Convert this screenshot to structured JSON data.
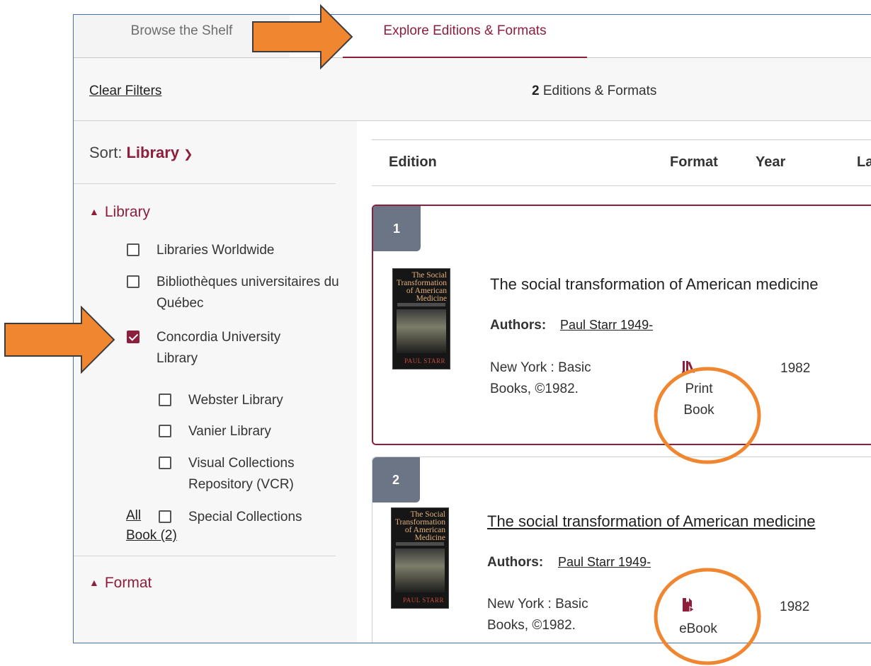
{
  "tabs": {
    "shelf": "Browse the Shelf",
    "editions": "Explore Editions & Formats"
  },
  "filter_bar": {
    "clear": "Clear Filters",
    "count": "2",
    "count_suffix": " Editions & Formats"
  },
  "sort": {
    "label": "Sort:",
    "value": "Library"
  },
  "library_section": {
    "heading": "Library",
    "options": [
      {
        "label": "Libraries Worldwide",
        "checked": false
      },
      {
        "label": "Bibliothèques universitaires du Québec",
        "checked": false
      },
      {
        "label": "Concordia University Library",
        "checked": true
      }
    ],
    "sub_options": [
      {
        "label": "Webster Library",
        "checked": false
      },
      {
        "label": "Vanier Library",
        "checked": false
      },
      {
        "label": "Visual Collections Repository (VCR)",
        "checked": false
      },
      {
        "label": "Special Collections",
        "checked": false
      }
    ]
  },
  "format_section": {
    "heading": "Format",
    "all": "All",
    "book": "Book (2)"
  },
  "columns": {
    "edition": "Edition",
    "format": "Format",
    "year": "Year",
    "language": "La"
  },
  "cover": {
    "title": "The Social Transformation of American Medicine",
    "author": "PAUL STARR"
  },
  "results": [
    {
      "number": "1",
      "title": "The social transformation of American medicine",
      "authors_label": "Authors:",
      "author": "Paul Starr 1949-",
      "publisher": "New York : Basic Books, ©1982.",
      "format_icon": "print-book-icon",
      "format": "Print Book",
      "year": "1982"
    },
    {
      "number": "2",
      "title": "The social transformation of American medicine",
      "authors_label": "Authors:",
      "author": "Paul Starr 1949-",
      "publisher": "New York : Basic Books, ©1982.",
      "format_icon": "ebook-icon",
      "format": "eBook",
      "year": "1982"
    }
  ],
  "colors": {
    "accent": "#8d1e3c",
    "annotation": "#f0862f",
    "badge": "#6b7585"
  }
}
